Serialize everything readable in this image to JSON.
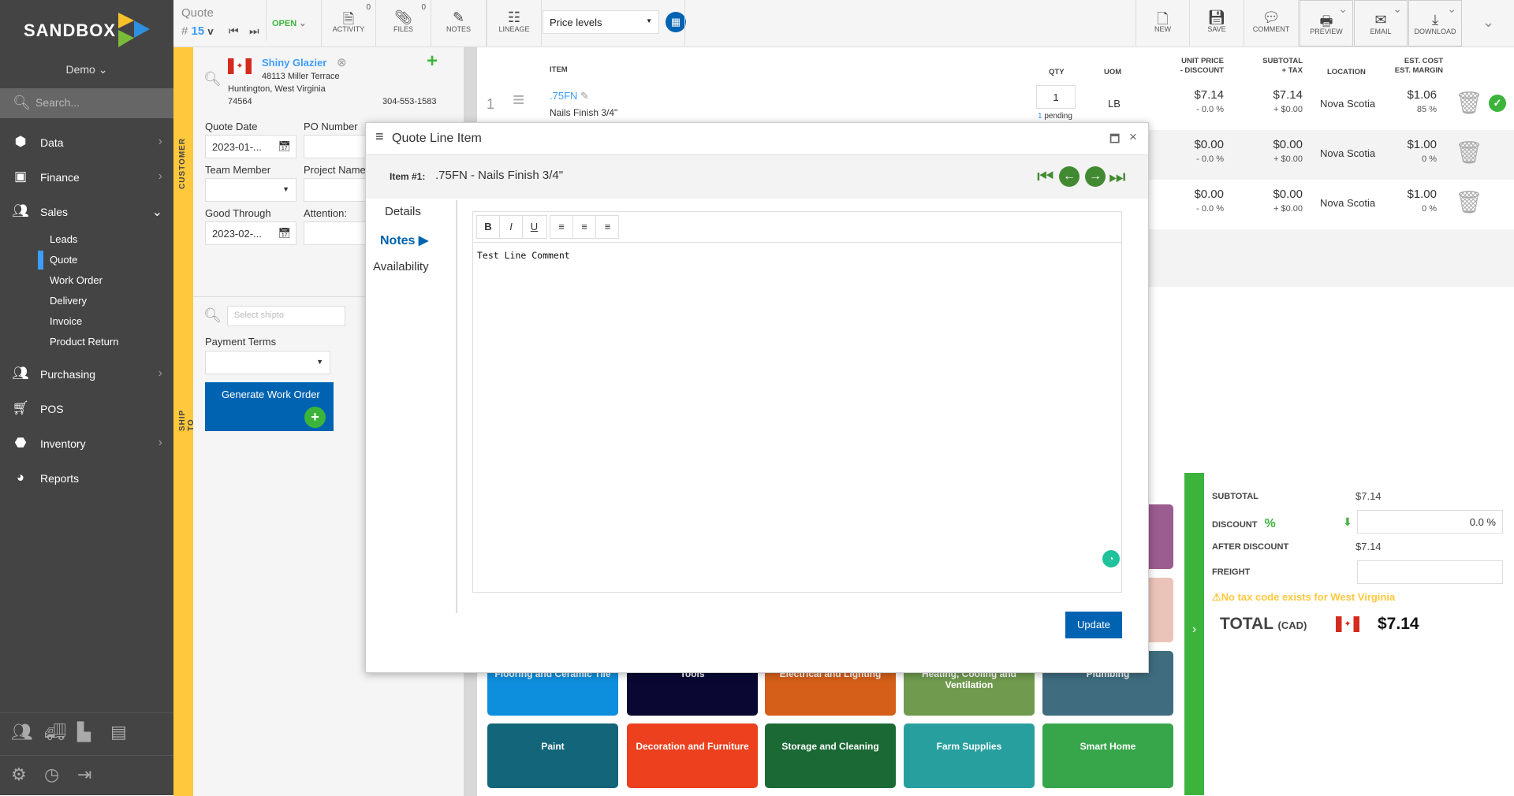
{
  "brand": {
    "name": "SANDBOX",
    "workspace": "Demo"
  },
  "sidebar": {
    "search_placeholder": "Search...",
    "items": [
      {
        "label": "Data",
        "icon": "cube-icon"
      },
      {
        "label": "Finance",
        "icon": "money-icon"
      },
      {
        "label": "Sales",
        "icon": "users-icon"
      },
      {
        "label": "Purchasing",
        "icon": "users-icon"
      },
      {
        "label": "POS",
        "icon": "cart-icon"
      },
      {
        "label": "Inventory",
        "icon": "cubes-icon"
      },
      {
        "label": "Reports",
        "icon": "pie-chart-icon"
      }
    ],
    "sales_sub": [
      "Leads",
      "Quote",
      "Work Order",
      "Delivery",
      "Invoice",
      "Product Return"
    ],
    "active_sub": "Quote"
  },
  "toolbar": {
    "doc_type": "Quote",
    "doc_number_prefix": "#",
    "doc_number": "15",
    "version": "v",
    "status": "OPEN",
    "activity": "ACTIVITY",
    "activity_count": "0",
    "files": "FILES",
    "files_count": "0",
    "notes": "NOTES",
    "lineage": "LINEAGE",
    "price_levels": "Price levels",
    "new": "NEW",
    "save": "SAVE",
    "comment": "COMMENT",
    "preview": "PREVIEW",
    "email": "EMAIL",
    "download": "DOWNLOAD"
  },
  "customer": {
    "section_label": "CUSTOMER",
    "name": "Shiny Glazier",
    "address1": "48113 Miller Terrace",
    "address2": "Huntington, West Virginia",
    "zip": "74564",
    "phone": "304-553-1583",
    "quote_date_label": "Quote Date",
    "quote_date": "2023-01-...",
    "po_label": "PO Number",
    "po": "",
    "team_label": "Team Member",
    "team": "",
    "project_label": "Project Name",
    "project": "",
    "good_through_label": "Good Through",
    "good_through": "2023-02-...",
    "attention_label": "Attention:",
    "attention": ""
  },
  "shipto": {
    "section_label": "SHIP TO",
    "placeholder": "Select shipto",
    "payment_terms_label": "Payment Terms",
    "payment_terms": "",
    "generate_button": "Generate Work Order"
  },
  "lines": {
    "headers": {
      "item": "ITEM",
      "qty": "QTY",
      "uom": "UOM",
      "unit_price": "UNIT PRICE",
      "discount": "- DISCOUNT",
      "subtotal": "SUBTOTAL",
      "tax": "+ TAX",
      "location": "LOCATION",
      "est_cost": "EST. COST",
      "est_margin": "EST. MARGIN"
    },
    "rows": [
      {
        "num": "1",
        "code": ".75FN",
        "desc": "Nails Finish 3/4\"",
        "qty": "1",
        "pending_count": "1",
        "pending_label": "pending",
        "uom": "LB",
        "price": "$7.14",
        "discount": "- 0.0 %",
        "subtotal": "$7.14",
        "tax": "+ $0.00",
        "location": "Nova Scotia",
        "cost": "$1.06",
        "margin": "85 %",
        "status": "ok"
      },
      {
        "price": "$0.00",
        "discount": "- 0.0 %",
        "subtotal": "$0.00",
        "tax": "+ $0.00",
        "location": "Nova Scotia",
        "cost": "$1.00",
        "margin": "0 %"
      },
      {
        "price": "$0.00",
        "discount": "- 0.0 %",
        "subtotal": "$0.00",
        "tax": "+ $0.00",
        "location": "Nova Scotia",
        "cost": "$1.00",
        "margin": "0 %"
      }
    ]
  },
  "tiles": [
    {
      "label": "",
      "color": "#9b5c8f"
    },
    {
      "label": "",
      "color": "#ebc4b9"
    },
    {
      "label": "Flooring and Ceramic Tile",
      "color": "#0e8fdd"
    },
    {
      "label": "Tools",
      "color": "#0a0833"
    },
    {
      "label": "Electrical and Lighting",
      "color": "#d55f19"
    },
    {
      "label": "Heating, Cooling and Ventilation",
      "color": "#709b4f"
    },
    {
      "label": "Plumbing",
      "color": "#3f6d7f"
    },
    {
      "label": "Paint",
      "color": "#13657a"
    },
    {
      "label": "Decoration and Furniture",
      "color": "#ec401e"
    },
    {
      "label": "Storage and Cleaning",
      "color": "#1b6935"
    },
    {
      "label": "Farm Supplies",
      "color": "#279f9f"
    },
    {
      "label": "Smart Home",
      "color": "#37a64b"
    }
  ],
  "totals": {
    "subtotal_label": "SUBTOTAL",
    "subtotal": "$7.14",
    "discount_label": "DISCOUNT",
    "discount_symbol": "%",
    "discount": "0.0 %",
    "after_label": "AFTER DISCOUNT",
    "after": "$7.14",
    "freight_label": "FREIGHT",
    "freight": "",
    "warning": "No tax code exists for West Virginia",
    "total_label": "TOTAL",
    "currency": "(CAD)",
    "total": "$7.14"
  },
  "modal": {
    "title": "Quote Line Item",
    "item_label": "Item #1:",
    "item_value": ".75FN - Nails Finish 3/4\"",
    "tabs": [
      "Details",
      "Notes",
      "Availability"
    ],
    "active_tab": "Notes",
    "note_text": "Test Line Comment",
    "update_button": "Update"
  },
  "colors": {
    "accent": "#0063b1",
    "green": "#3cb43c",
    "yellow": "#ffc83d",
    "link": "#3d9dfd",
    "sidebar": "#444444"
  }
}
